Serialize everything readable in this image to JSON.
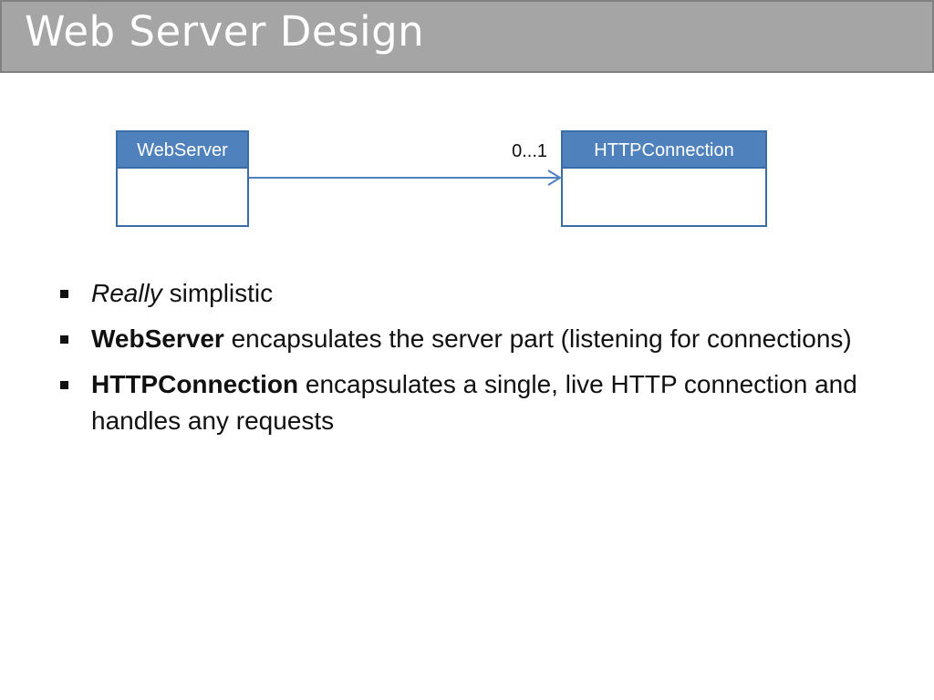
{
  "slide": {
    "title": "Web Server Design"
  },
  "diagram": {
    "classes": [
      {
        "id": "webserver",
        "name": "WebServer"
      },
      {
        "id": "httpconnection",
        "name": "HTTPConnection"
      }
    ],
    "association": {
      "from": "webserver",
      "to": "httpconnection",
      "multiplicity": "0...1",
      "navigable_to_target": true
    },
    "colors": {
      "class_header_fill": "#4f81bd",
      "class_border": "#3b6ca8",
      "class_body_fill": "#ffffff",
      "header_text": "#ffffff",
      "association_line": "#4f81bd",
      "title_bar": "#a5a5a5"
    }
  },
  "bullets": [
    {
      "lead": "Really",
      "lead_style": "italic",
      "rest": " simplistic"
    },
    {
      "lead": "WebServer",
      "lead_style": "bold",
      "rest": " encapsulates the server part (listening for connections)"
    },
    {
      "lead": "HTTPConnection",
      "lead_style": "bold",
      "rest": " encapsulates a single, live HTTP connection and handles any requests"
    }
  ]
}
